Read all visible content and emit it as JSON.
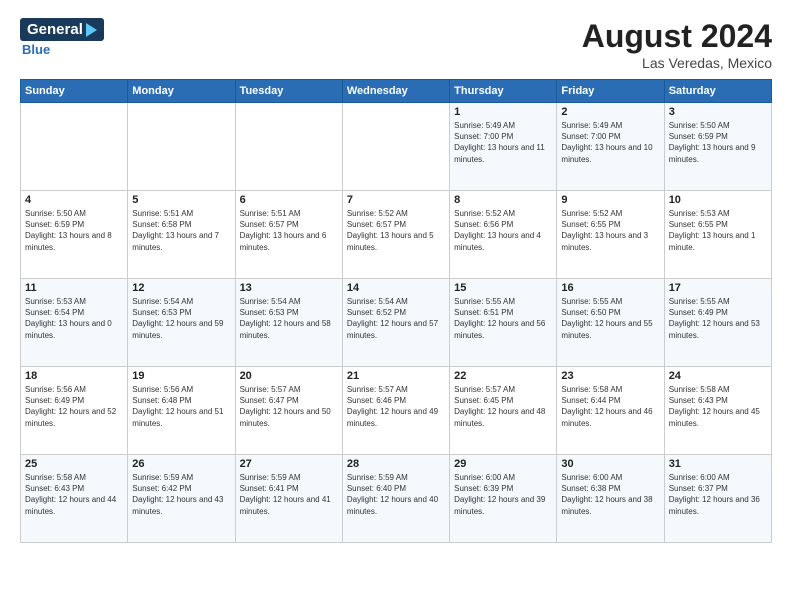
{
  "header": {
    "logo_general": "General",
    "logo_blue": "Blue",
    "month_year": "August 2024",
    "location": "Las Veredas, Mexico"
  },
  "days_of_week": [
    "Sunday",
    "Monday",
    "Tuesday",
    "Wednesday",
    "Thursday",
    "Friday",
    "Saturday"
  ],
  "weeks": [
    [
      {
        "num": "",
        "sunrise": "",
        "sunset": "",
        "daylight": ""
      },
      {
        "num": "",
        "sunrise": "",
        "sunset": "",
        "daylight": ""
      },
      {
        "num": "",
        "sunrise": "",
        "sunset": "",
        "daylight": ""
      },
      {
        "num": "",
        "sunrise": "",
        "sunset": "",
        "daylight": ""
      },
      {
        "num": "1",
        "sunrise": "Sunrise: 5:49 AM",
        "sunset": "Sunset: 7:00 PM",
        "daylight": "Daylight: 13 hours and 11 minutes."
      },
      {
        "num": "2",
        "sunrise": "Sunrise: 5:49 AM",
        "sunset": "Sunset: 7:00 PM",
        "daylight": "Daylight: 13 hours and 10 minutes."
      },
      {
        "num": "3",
        "sunrise": "Sunrise: 5:50 AM",
        "sunset": "Sunset: 6:59 PM",
        "daylight": "Daylight: 13 hours and 9 minutes."
      }
    ],
    [
      {
        "num": "4",
        "sunrise": "Sunrise: 5:50 AM",
        "sunset": "Sunset: 6:59 PM",
        "daylight": "Daylight: 13 hours and 8 minutes."
      },
      {
        "num": "5",
        "sunrise": "Sunrise: 5:51 AM",
        "sunset": "Sunset: 6:58 PM",
        "daylight": "Daylight: 13 hours and 7 minutes."
      },
      {
        "num": "6",
        "sunrise": "Sunrise: 5:51 AM",
        "sunset": "Sunset: 6:57 PM",
        "daylight": "Daylight: 13 hours and 6 minutes."
      },
      {
        "num": "7",
        "sunrise": "Sunrise: 5:52 AM",
        "sunset": "Sunset: 6:57 PM",
        "daylight": "Daylight: 13 hours and 5 minutes."
      },
      {
        "num": "8",
        "sunrise": "Sunrise: 5:52 AM",
        "sunset": "Sunset: 6:56 PM",
        "daylight": "Daylight: 13 hours and 4 minutes."
      },
      {
        "num": "9",
        "sunrise": "Sunrise: 5:52 AM",
        "sunset": "Sunset: 6:55 PM",
        "daylight": "Daylight: 13 hours and 3 minutes."
      },
      {
        "num": "10",
        "sunrise": "Sunrise: 5:53 AM",
        "sunset": "Sunset: 6:55 PM",
        "daylight": "Daylight: 13 hours and 1 minute."
      }
    ],
    [
      {
        "num": "11",
        "sunrise": "Sunrise: 5:53 AM",
        "sunset": "Sunset: 6:54 PM",
        "daylight": "Daylight: 13 hours and 0 minutes."
      },
      {
        "num": "12",
        "sunrise": "Sunrise: 5:54 AM",
        "sunset": "Sunset: 6:53 PM",
        "daylight": "Daylight: 12 hours and 59 minutes."
      },
      {
        "num": "13",
        "sunrise": "Sunrise: 5:54 AM",
        "sunset": "Sunset: 6:53 PM",
        "daylight": "Daylight: 12 hours and 58 minutes."
      },
      {
        "num": "14",
        "sunrise": "Sunrise: 5:54 AM",
        "sunset": "Sunset: 6:52 PM",
        "daylight": "Daylight: 12 hours and 57 minutes."
      },
      {
        "num": "15",
        "sunrise": "Sunrise: 5:55 AM",
        "sunset": "Sunset: 6:51 PM",
        "daylight": "Daylight: 12 hours and 56 minutes."
      },
      {
        "num": "16",
        "sunrise": "Sunrise: 5:55 AM",
        "sunset": "Sunset: 6:50 PM",
        "daylight": "Daylight: 12 hours and 55 minutes."
      },
      {
        "num": "17",
        "sunrise": "Sunrise: 5:55 AM",
        "sunset": "Sunset: 6:49 PM",
        "daylight": "Daylight: 12 hours and 53 minutes."
      }
    ],
    [
      {
        "num": "18",
        "sunrise": "Sunrise: 5:56 AM",
        "sunset": "Sunset: 6:49 PM",
        "daylight": "Daylight: 12 hours and 52 minutes."
      },
      {
        "num": "19",
        "sunrise": "Sunrise: 5:56 AM",
        "sunset": "Sunset: 6:48 PM",
        "daylight": "Daylight: 12 hours and 51 minutes."
      },
      {
        "num": "20",
        "sunrise": "Sunrise: 5:57 AM",
        "sunset": "Sunset: 6:47 PM",
        "daylight": "Daylight: 12 hours and 50 minutes."
      },
      {
        "num": "21",
        "sunrise": "Sunrise: 5:57 AM",
        "sunset": "Sunset: 6:46 PM",
        "daylight": "Daylight: 12 hours and 49 minutes."
      },
      {
        "num": "22",
        "sunrise": "Sunrise: 5:57 AM",
        "sunset": "Sunset: 6:45 PM",
        "daylight": "Daylight: 12 hours and 48 minutes."
      },
      {
        "num": "23",
        "sunrise": "Sunrise: 5:58 AM",
        "sunset": "Sunset: 6:44 PM",
        "daylight": "Daylight: 12 hours and 46 minutes."
      },
      {
        "num": "24",
        "sunrise": "Sunrise: 5:58 AM",
        "sunset": "Sunset: 6:43 PM",
        "daylight": "Daylight: 12 hours and 45 minutes."
      }
    ],
    [
      {
        "num": "25",
        "sunrise": "Sunrise: 5:58 AM",
        "sunset": "Sunset: 6:43 PM",
        "daylight": "Daylight: 12 hours and 44 minutes."
      },
      {
        "num": "26",
        "sunrise": "Sunrise: 5:59 AM",
        "sunset": "Sunset: 6:42 PM",
        "daylight": "Daylight: 12 hours and 43 minutes."
      },
      {
        "num": "27",
        "sunrise": "Sunrise: 5:59 AM",
        "sunset": "Sunset: 6:41 PM",
        "daylight": "Daylight: 12 hours and 41 minutes."
      },
      {
        "num": "28",
        "sunrise": "Sunrise: 5:59 AM",
        "sunset": "Sunset: 6:40 PM",
        "daylight": "Daylight: 12 hours and 40 minutes."
      },
      {
        "num": "29",
        "sunrise": "Sunrise: 6:00 AM",
        "sunset": "Sunset: 6:39 PM",
        "daylight": "Daylight: 12 hours and 39 minutes."
      },
      {
        "num": "30",
        "sunrise": "Sunrise: 6:00 AM",
        "sunset": "Sunset: 6:38 PM",
        "daylight": "Daylight: 12 hours and 38 minutes."
      },
      {
        "num": "31",
        "sunrise": "Sunrise: 6:00 AM",
        "sunset": "Sunset: 6:37 PM",
        "daylight": "Daylight: 12 hours and 36 minutes."
      }
    ]
  ]
}
